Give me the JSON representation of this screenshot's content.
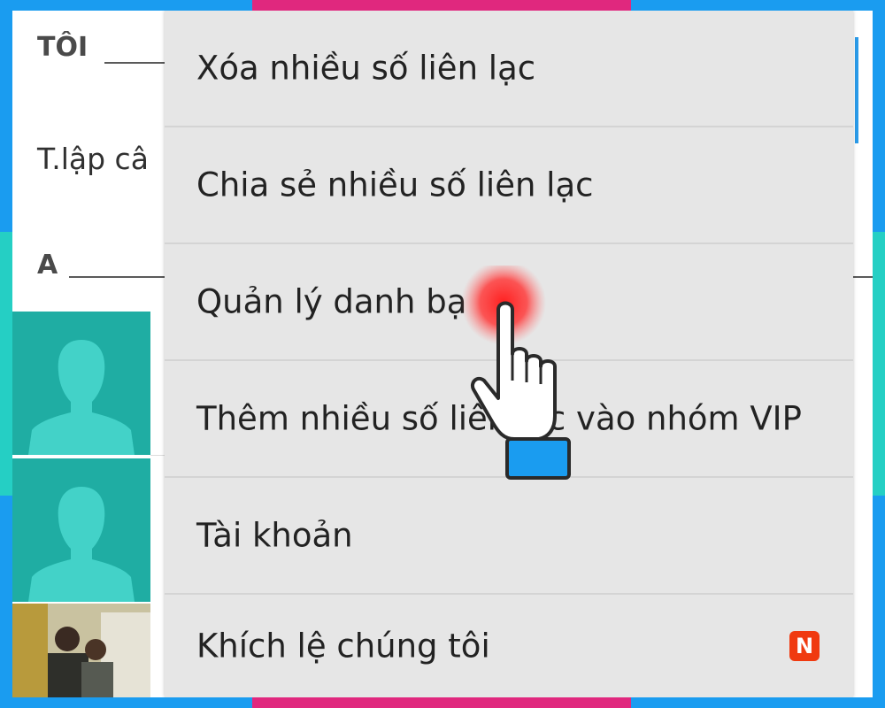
{
  "contacts": {
    "section_me": "TÔI",
    "me_contact": "T.lập câ",
    "section_a": "A"
  },
  "menu": {
    "items": [
      {
        "label": "Xóa nhiều số liên lạc"
      },
      {
        "label": "Chia sẻ nhiều số liên lạc"
      },
      {
        "label": "Quản lý danh bạ"
      },
      {
        "label": "Thêm nhiều số liên lạc vào nhóm VIP"
      },
      {
        "label": "Tài khoản"
      },
      {
        "label": "Khích lệ chúng tôi",
        "badge": "N"
      }
    ]
  },
  "colors": {
    "frame": "#1a9cf0",
    "accent_pink": "#e0287e",
    "accent_teal": "#25cfc4",
    "avatar_bg": "#1fada3",
    "menu_bg": "#e6e6e6",
    "badge": "#f03a10",
    "tap_highlight": "#ff2020"
  },
  "icons": {
    "avatar": "person-silhouette-icon",
    "cursor": "pointing-hand-icon"
  }
}
